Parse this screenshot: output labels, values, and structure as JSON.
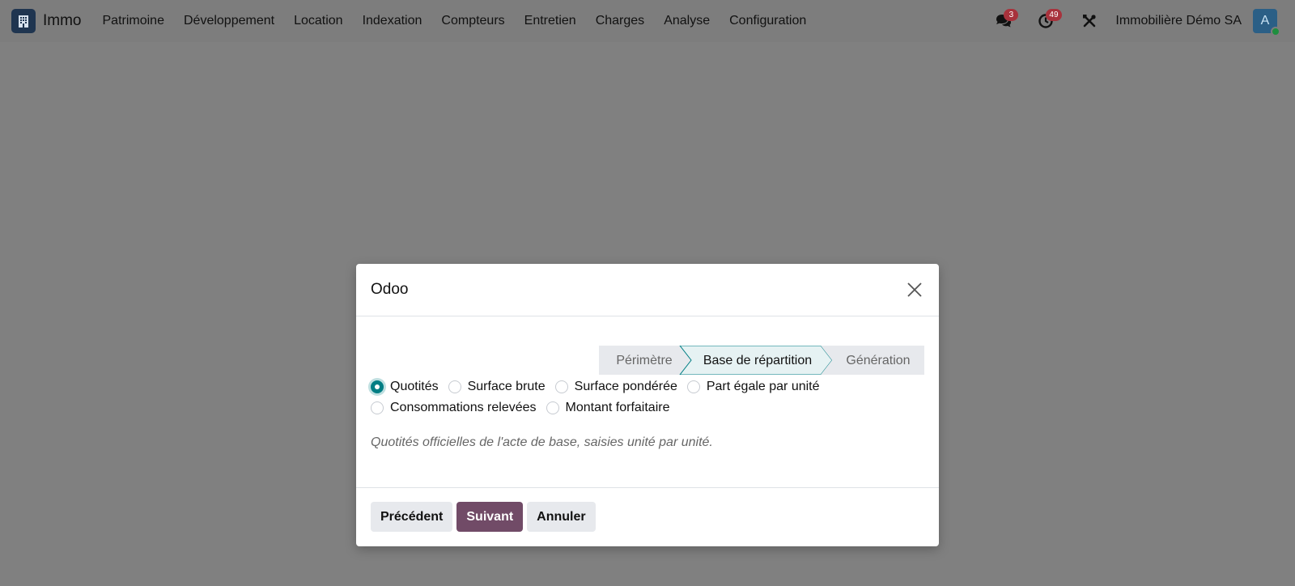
{
  "navbar": {
    "brand": "Immo",
    "menu": [
      "Patrimoine",
      "Développement",
      "Location",
      "Indexation",
      "Compteurs",
      "Entretien",
      "Charges",
      "Analyse",
      "Configuration"
    ],
    "messages_count": "3",
    "activities_count": "49",
    "company": "Immobilière Démo SA",
    "avatar_letter": "A"
  },
  "dialog": {
    "title": "Odoo",
    "steps": [
      "Périmètre",
      "Base de répartition",
      "Génération"
    ],
    "active_step": "Base de répartition",
    "options": [
      "Quotités",
      "Surface brute",
      "Surface pondérée",
      "Part égale par unité",
      "Consommations relevées",
      "Montant forfaitaire"
    ],
    "selected_option": "Quotités",
    "help": "Quotités officielles de l'acte de base, saisies unité par unité.",
    "buttons": {
      "previous": "Précédent",
      "next": "Suivant",
      "cancel": "Annuler"
    }
  },
  "colors": {
    "primary": "#714b67",
    "accent": "#017e84",
    "badge": "#a8323c"
  }
}
